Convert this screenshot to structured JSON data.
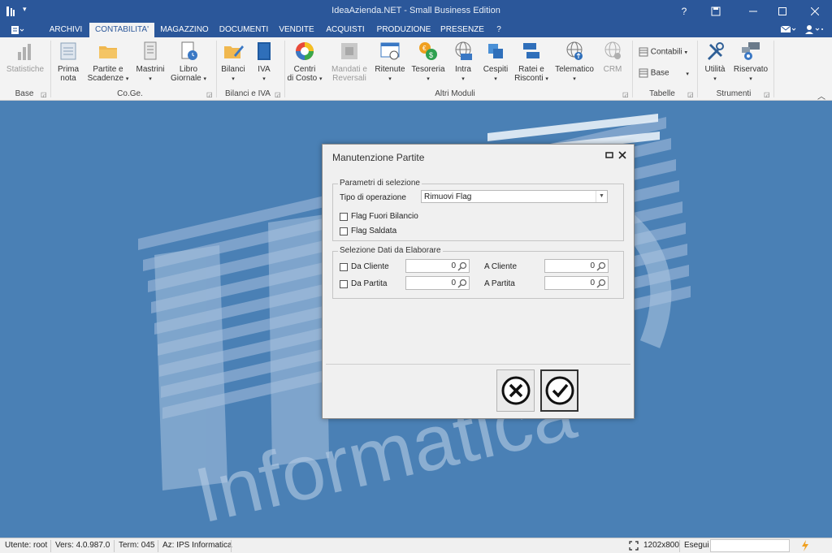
{
  "window": {
    "title": "IdeaAzienda.NET - Small Business Edition",
    "help_label": "?"
  },
  "tabs": [
    {
      "label": "ARCHIVI"
    },
    {
      "label": "CONTABILITA'"
    },
    {
      "label": "MAGAZZINO"
    },
    {
      "label": "DOCUMENTI"
    },
    {
      "label": "VENDITE"
    },
    {
      "label": "ACQUISTI"
    },
    {
      "label": "PRODUZIONE"
    },
    {
      "label": "PRESENZE"
    },
    {
      "label": "?"
    }
  ],
  "ribbon": {
    "groups": {
      "base": "Base",
      "coge": "Co.Ge.",
      "bilanci_iva": "Bilanci e IVA",
      "altri_moduli": "Altri Moduli",
      "tabelle": "Tabelle",
      "strumenti": "Strumenti"
    },
    "items": {
      "statistiche": "Statistiche",
      "prima_nota_1": "Prima",
      "prima_nota_2": "nota",
      "partite_1": "Partite e",
      "partite_2": "Scadenze",
      "mastrini": "Mastrini",
      "libro_1": "Libro",
      "libro_2": "Giornale",
      "bilanci": "Bilanci",
      "iva": "IVA",
      "centri_1": "Centri",
      "centri_2": "di Costo",
      "mandati_1": "Mandati e",
      "mandati_2": "Reversali",
      "ritenute": "Ritenute",
      "tesoreria": "Tesoreria",
      "intra": "Intra",
      "cespiti": "Cespiti",
      "ratei_1": "Ratei e",
      "ratei_2": "Risconti",
      "telematico": "Telematico",
      "crm": "CRM",
      "contabili": "Contabili",
      "base_small": "Base",
      "utilita": "Utilità",
      "riservato": "Riservato"
    }
  },
  "dialog": {
    "title": "Manutenzione Partite",
    "section1_legend": "Parametri di selezione",
    "tipo_label": "Tipo di operazione",
    "tipo_value": "Rimuovi Flag",
    "flag_fuori_bilancio": "Flag Fuori Bilancio",
    "flag_saldata": "Flag Saldata",
    "section2_legend": "Selezione Dati da Elaborare",
    "da_cliente": "Da Cliente",
    "a_cliente": "A Cliente",
    "da_partita": "Da Partita",
    "a_partita": "A Partita",
    "da_cliente_value": "0",
    "a_cliente_value": "0",
    "da_partita_value": "0",
    "a_partita_value": "0"
  },
  "statusbar": {
    "utente": "Utente: root",
    "versione": "Vers: 4.0.987.0",
    "terminale": "Term: 045",
    "azienda": "Az: IPS Informatica",
    "resolution": "1202x800",
    "esegui": "Esegui"
  },
  "background": {
    "watermark_text": "Informatica"
  },
  "colors": {
    "title_bar": "#2b579a",
    "desktop": "#4a80b5",
    "ribbon": "#f3f3f3"
  }
}
